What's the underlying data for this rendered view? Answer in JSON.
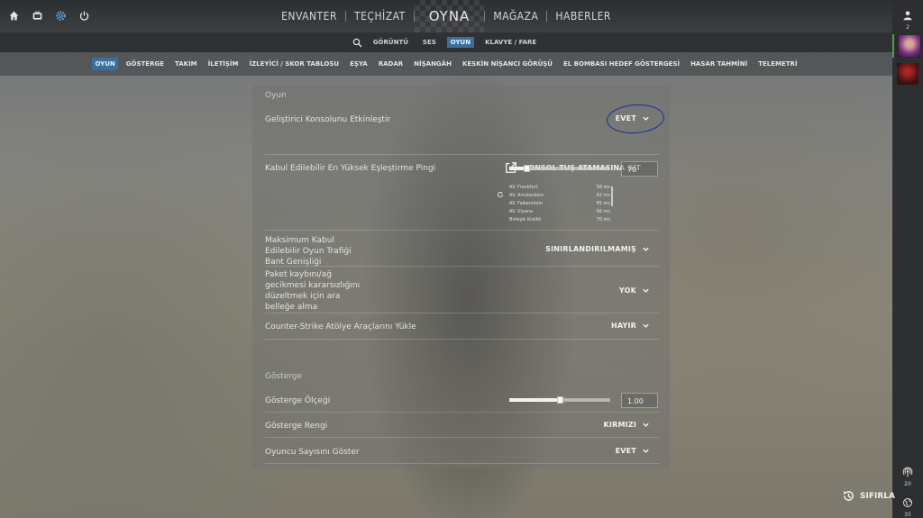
{
  "top_icons": [
    "home-icon",
    "tv-icon",
    "settings-icon",
    "power-icon"
  ],
  "main_nav": {
    "inventory": "ENVANTER",
    "loadout": "TEÇHİZAT",
    "play": "OYNA",
    "store": "MAĞAZA",
    "news": "HABERLER"
  },
  "sub_nav": {
    "items": [
      "GÖRÜNTÜ",
      "SES",
      "OYUN",
      "KLAVYE / FARE"
    ],
    "active": "OYUN"
  },
  "tabs": {
    "items": [
      "OYUN",
      "GÖSTERGE",
      "TAKIM",
      "İLETİŞİM",
      "İZLEYİCİ / SKOR TABLOSU",
      "EŞYA",
      "RADAR",
      "NİŞANGÂH",
      "KESKİN NİŞANCI GÖRÜŞÜ",
      "EL BOMBASI HEDEF GÖSTERGESİ",
      "HASAR TAHMİNİ",
      "TELEMETRİ"
    ],
    "active": "OYUN"
  },
  "rail": {
    "friends_count": "2",
    "bottom1_count": "20",
    "bottom2_count": "35"
  },
  "game_section": {
    "title": "Oyun",
    "dev_console_label": "Geliştirici Konsolunu Etkinleştir",
    "dev_console_value": "EVET",
    "console_link": "KONSOL TUŞ ATAMASINA GİT",
    "ping_label": "Kabul Edilebilir En Yüksek Eşleştirme Pingi",
    "ping_value": "70",
    "ping_slider_fraction": 0.17,
    "ping_servers": [
      {
        "name": "AV. Frankfurt",
        "ms": "58 ms"
      },
      {
        "name": "AV. Amsterdam",
        "ms": "62 ms"
      },
      {
        "name": "AV. Falkenstein",
        "ms": "65 ms"
      },
      {
        "name": "AV. Viyana",
        "ms": "66 ms"
      },
      {
        "name": "Birleşik Krallık",
        "ms": "70 ms"
      }
    ],
    "bandwidth_label_1": "Maksimum Kabul",
    "bandwidth_label_2": "Edilebilir Oyun Trafiği",
    "bandwidth_label_3": "Bant Genişliği",
    "bandwidth_value": "SINIRLANDIRILMAMIŞ",
    "buffer_label_1": "Paket kaybını/ağ",
    "buffer_label_2": "gecikmesi kararsızlığını",
    "buffer_label_3": "düzeltmek için ara",
    "buffer_label_4": "belleğe alma",
    "buffer_value": "YOK",
    "workshop_label": "Counter-Strike Atölye Araçlarını Yükle",
    "workshop_value": "HAYIR"
  },
  "hud_section": {
    "title": "Gösterge",
    "scale_label": "Gösterge Ölçeği",
    "scale_value": "1.00",
    "scale_slider_fraction": 0.5,
    "color_label": "Gösterge Rengi",
    "color_value": "KIRMIZI",
    "player_count_label": "Oyuncu Sayısını Göster",
    "player_count_value": "EVET"
  },
  "reset_label": "SIFIRLA",
  "colors": {
    "accent": "#3a6f9c",
    "annotation": "#1a2f9c",
    "online": "#4aa53b"
  }
}
